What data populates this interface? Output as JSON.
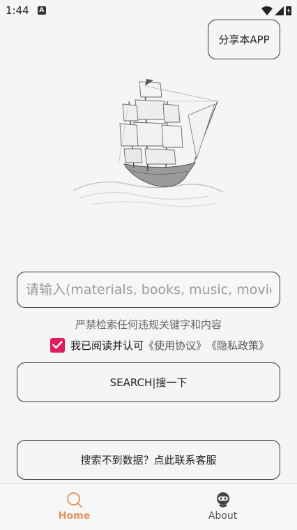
{
  "status_bar": {
    "time": "1:44",
    "badge": "A"
  },
  "share_button": {
    "label": "分享本APP"
  },
  "search": {
    "placeholder": "请输入(materials, books, music, movie",
    "value": ""
  },
  "warning_text": "严禁检索任何违规关键字和内容",
  "agreement": {
    "checked": true,
    "text": "我已阅读并认可",
    "terms_link": "《使用协议》",
    "privacy_link": "《隐私政策》"
  },
  "search_button": {
    "label": "SEARCH|搜一下"
  },
  "contact_button": {
    "label": "搜索不到数据？点此联系客服"
  },
  "bottom_nav": {
    "items": [
      {
        "label": "Home",
        "icon": "search-icon",
        "active": true
      },
      {
        "label": "About",
        "icon": "robot-icon",
        "active": false
      }
    ]
  },
  "colors": {
    "accent": "#e8925a",
    "checkbox": "#e31c5f"
  }
}
